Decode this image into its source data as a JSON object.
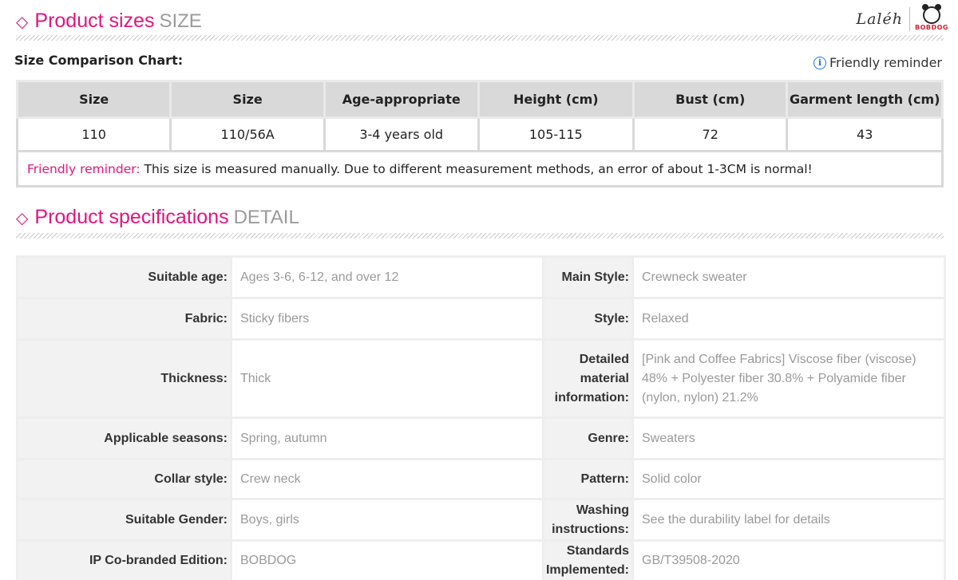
{
  "sizes_section": {
    "title": "Product sizes",
    "subtitle": "SIZE"
  },
  "logo": {
    "signature": "Laléh",
    "brand": "BOBDOG"
  },
  "size_chart": {
    "label": "Size Comparison Chart:",
    "reminder_link": "Friendly reminder",
    "info_icon": "info-icon",
    "headers": [
      "Size",
      "Size",
      "Age-appropriate",
      "Height (cm)",
      "Bust (cm)",
      "Garment length (cm)"
    ],
    "row": [
      "110",
      "110/56A",
      "3-4 years old",
      "105-115",
      "72",
      "43"
    ],
    "note_label": "Friendly reminder:",
    "note_text": " This size is measured manually. Due to different measurement methods, an error of about 1-3CM is normal!"
  },
  "spec_section": {
    "title": "Product specifications",
    "subtitle": "DETAIL"
  },
  "specs": [
    {
      "lk": "Suitable age:",
      "lv": "Ages 3-6, 6-12, and over 12",
      "rk": "Main Style:",
      "rv": "Crewneck sweater"
    },
    {
      "lk": "Fabric:",
      "lv": "Sticky fibers",
      "rk": "Style:",
      "rv": "Relaxed"
    },
    {
      "lk": "Thickness:",
      "lv": "Thick",
      "rk": "Detailed material information:",
      "rv": "[Pink and Coffee Fabrics] Viscose fiber (viscose) 48% + Polyester fiber 30.8% + Polyamide fiber (nylon, nylon) 21.2%"
    },
    {
      "lk": "Applicable seasons:",
      "lv": "Spring, autumn",
      "rk": "Genre:",
      "rv": "Sweaters"
    },
    {
      "lk": "Collar style:",
      "lv": "Crew neck",
      "rk": "Pattern:",
      "rv": "Solid color"
    },
    {
      "lk": "Suitable Gender:",
      "lv": "Boys, girls",
      "rk": "Washing instructions:",
      "rv": "See the durability label for details"
    },
    {
      "lk": "IP Co-branded Edition:",
      "lv": "BOBDOG",
      "rk": "Standards Implemented:",
      "rv": "GB/T39508-2020"
    }
  ]
}
